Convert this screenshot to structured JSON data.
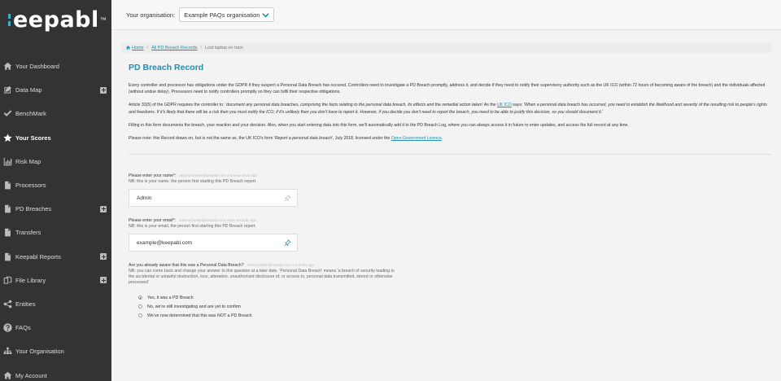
{
  "brand": {
    "name": "eepabl",
    "tm": "™"
  },
  "sidebar": {
    "items": [
      {
        "label": "Your Dashboard",
        "icon": "home-icon",
        "has_plus": false,
        "active": false
      },
      {
        "label": "Data Map",
        "icon": "edit-icon",
        "has_plus": true,
        "active": false
      },
      {
        "label": "BenchMark",
        "icon": "check-icon",
        "has_plus": false,
        "active": false
      },
      {
        "label": "Your Scores",
        "icon": "star-icon",
        "has_plus": false,
        "active": true
      },
      {
        "label": "Risk Map",
        "icon": "bar-chart-icon",
        "has_plus": false,
        "active": false
      },
      {
        "label": "Processors",
        "icon": "file-icon",
        "has_plus": false,
        "active": false
      },
      {
        "label": "PD Breaches",
        "icon": "file-icon",
        "has_plus": true,
        "active": false
      },
      {
        "label": "Transfers",
        "icon": "file-icon",
        "has_plus": false,
        "active": false
      },
      {
        "label": "Keepabl Reports",
        "icon": "file-icon",
        "has_plus": true,
        "active": false
      },
      {
        "label": "File Library",
        "icon": "copy-icon",
        "has_plus": true,
        "active": false
      },
      {
        "label": "Entities",
        "icon": "share-icon",
        "has_plus": false,
        "active": false
      },
      {
        "label": "FAQs",
        "icon": "question-icon",
        "has_plus": false,
        "active": false
      },
      {
        "label": "Your Organisation",
        "icon": "sitemap-icon",
        "has_plus": false,
        "active": false
      },
      {
        "label": "My Account",
        "icon": "home-icon",
        "has_plus": false,
        "active": false
      }
    ]
  },
  "topbar": {
    "org_label": "Your organisation:",
    "org_value": "Example PAQs organisation"
  },
  "breadcrumb": {
    "home": "Home",
    "all": "All PD Breach Records",
    "current": "Lost laptop on train"
  },
  "page": {
    "title": "PD Breach Record",
    "p1": "Every controller and processor has obligations under the GDPR if they suspect a Personal Data Breach has occured. Controllers need to investigate a PD Breach promptly, address it, and decide if they need to notify their supervisory authority such as the UK ICO (within 72 hours of becoming aware of the breach) and the individuals affected (without undue delay). Processors need to notify controllers promptly so they can fulfil their respective obligations.",
    "p2_a": "Article 33(5) of the GDPR requires the controller to: ",
    "p2_b": "'document any personal data breaches, comprising the facts relating to the personal data breach, its effects and the remedial action taken'",
    "p2_c": " As the ",
    "p2_link": "UK ICO",
    "p2_d": " says: ",
    "p2_e": "'When a personal data breach has occurred, you need to establish the likelihood and severity of the resulting risk to people's rights and freedoms. If it's likely that there will be a risk then you must notify the ICO; if it's unlikely then you don't have to report it. However, if you decide you don't need to report the breach, you need to be able to justify this decision, so you should document it.'",
    "p3": "Filling in this form documents the breach, your reaction and your decision. Also, when you start entering data into this form, we'll automatically add it to the PD Breach Log, where you can always access it in future to enter updates, and access the full record at any time.",
    "p4_a": "Please note: this Record draws on, but is not the same as, the UK ICO's form ",
    "p4_b": "'Report a personal data breach'",
    "p4_c": ", July 2018, licensed under the ",
    "p4_link": "Open Government Licence",
    "p4_d": "."
  },
  "form": {
    "name": {
      "label": "Please enter your name*:",
      "meta": "andrew.barker@keepabl.com a few seconds ago",
      "hint": "NB: this is your name, the person first starting this PD Breach report.",
      "value": "Admin"
    },
    "email": {
      "label": "Please enter your email*:",
      "meta": "andrew.barker@keepabl.com a few seconds ago",
      "hint": "NB: this is your email, the person first starting this PD Breach report.",
      "value": "example@keepabl.com"
    },
    "aware": {
      "label": "Are you already aware that this was a Personal Data Breach?",
      "meta": "robert.barker@keepabl.com 2 months ago",
      "hint": "NB: you can come back and change your answer to this question at a later date. 'Personal Data Breach' means 'a breach of security leading to the accidental or unlawful destruction, loss, alteration, unauthorised disclosure of, or access to, personal data transmitted, stored or otherwise processed'",
      "options": [
        {
          "label": "Yes, it was a PD Breach",
          "checked": true
        },
        {
          "label": "No, we're still investigating and are yet to confirm",
          "checked": false
        },
        {
          "label": "We've now determined that this was NOT a PD Breach",
          "checked": false
        }
      ]
    }
  }
}
